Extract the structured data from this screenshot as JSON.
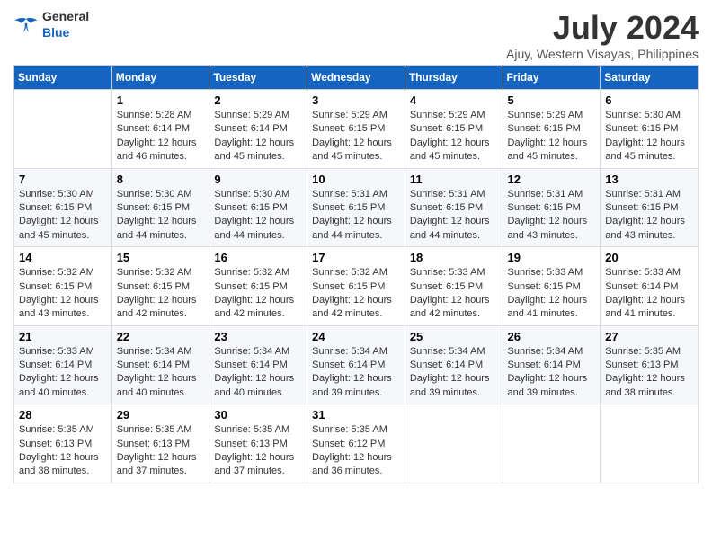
{
  "logo": {
    "general": "General",
    "blue": "Blue"
  },
  "title": "July 2024",
  "subtitle": "Ajuy, Western Visayas, Philippines",
  "header_days": [
    "Sunday",
    "Monday",
    "Tuesday",
    "Wednesday",
    "Thursday",
    "Friday",
    "Saturday"
  ],
  "weeks": [
    [
      {
        "day": "",
        "info": ""
      },
      {
        "day": "1",
        "info": "Sunrise: 5:28 AM\nSunset: 6:14 PM\nDaylight: 12 hours\nand 46 minutes."
      },
      {
        "day": "2",
        "info": "Sunrise: 5:29 AM\nSunset: 6:14 PM\nDaylight: 12 hours\nand 45 minutes."
      },
      {
        "day": "3",
        "info": "Sunrise: 5:29 AM\nSunset: 6:15 PM\nDaylight: 12 hours\nand 45 minutes."
      },
      {
        "day": "4",
        "info": "Sunrise: 5:29 AM\nSunset: 6:15 PM\nDaylight: 12 hours\nand 45 minutes."
      },
      {
        "day": "5",
        "info": "Sunrise: 5:29 AM\nSunset: 6:15 PM\nDaylight: 12 hours\nand 45 minutes."
      },
      {
        "day": "6",
        "info": "Sunrise: 5:30 AM\nSunset: 6:15 PM\nDaylight: 12 hours\nand 45 minutes."
      }
    ],
    [
      {
        "day": "7",
        "info": "Sunrise: 5:30 AM\nSunset: 6:15 PM\nDaylight: 12 hours\nand 45 minutes."
      },
      {
        "day": "8",
        "info": "Sunrise: 5:30 AM\nSunset: 6:15 PM\nDaylight: 12 hours\nand 44 minutes."
      },
      {
        "day": "9",
        "info": "Sunrise: 5:30 AM\nSunset: 6:15 PM\nDaylight: 12 hours\nand 44 minutes."
      },
      {
        "day": "10",
        "info": "Sunrise: 5:31 AM\nSunset: 6:15 PM\nDaylight: 12 hours\nand 44 minutes."
      },
      {
        "day": "11",
        "info": "Sunrise: 5:31 AM\nSunset: 6:15 PM\nDaylight: 12 hours\nand 44 minutes."
      },
      {
        "day": "12",
        "info": "Sunrise: 5:31 AM\nSunset: 6:15 PM\nDaylight: 12 hours\nand 43 minutes."
      },
      {
        "day": "13",
        "info": "Sunrise: 5:31 AM\nSunset: 6:15 PM\nDaylight: 12 hours\nand 43 minutes."
      }
    ],
    [
      {
        "day": "14",
        "info": "Sunrise: 5:32 AM\nSunset: 6:15 PM\nDaylight: 12 hours\nand 43 minutes."
      },
      {
        "day": "15",
        "info": "Sunrise: 5:32 AM\nSunset: 6:15 PM\nDaylight: 12 hours\nand 42 minutes."
      },
      {
        "day": "16",
        "info": "Sunrise: 5:32 AM\nSunset: 6:15 PM\nDaylight: 12 hours\nand 42 minutes."
      },
      {
        "day": "17",
        "info": "Sunrise: 5:32 AM\nSunset: 6:15 PM\nDaylight: 12 hours\nand 42 minutes."
      },
      {
        "day": "18",
        "info": "Sunrise: 5:33 AM\nSunset: 6:15 PM\nDaylight: 12 hours\nand 42 minutes."
      },
      {
        "day": "19",
        "info": "Sunrise: 5:33 AM\nSunset: 6:15 PM\nDaylight: 12 hours\nand 41 minutes."
      },
      {
        "day": "20",
        "info": "Sunrise: 5:33 AM\nSunset: 6:14 PM\nDaylight: 12 hours\nand 41 minutes."
      }
    ],
    [
      {
        "day": "21",
        "info": "Sunrise: 5:33 AM\nSunset: 6:14 PM\nDaylight: 12 hours\nand 40 minutes."
      },
      {
        "day": "22",
        "info": "Sunrise: 5:34 AM\nSunset: 6:14 PM\nDaylight: 12 hours\nand 40 minutes."
      },
      {
        "day": "23",
        "info": "Sunrise: 5:34 AM\nSunset: 6:14 PM\nDaylight: 12 hours\nand 40 minutes."
      },
      {
        "day": "24",
        "info": "Sunrise: 5:34 AM\nSunset: 6:14 PM\nDaylight: 12 hours\nand 39 minutes."
      },
      {
        "day": "25",
        "info": "Sunrise: 5:34 AM\nSunset: 6:14 PM\nDaylight: 12 hours\nand 39 minutes."
      },
      {
        "day": "26",
        "info": "Sunrise: 5:34 AM\nSunset: 6:14 PM\nDaylight: 12 hours\nand 39 minutes."
      },
      {
        "day": "27",
        "info": "Sunrise: 5:35 AM\nSunset: 6:13 PM\nDaylight: 12 hours\nand 38 minutes."
      }
    ],
    [
      {
        "day": "28",
        "info": "Sunrise: 5:35 AM\nSunset: 6:13 PM\nDaylight: 12 hours\nand 38 minutes."
      },
      {
        "day": "29",
        "info": "Sunrise: 5:35 AM\nSunset: 6:13 PM\nDaylight: 12 hours\nand 37 minutes."
      },
      {
        "day": "30",
        "info": "Sunrise: 5:35 AM\nSunset: 6:13 PM\nDaylight: 12 hours\nand 37 minutes."
      },
      {
        "day": "31",
        "info": "Sunrise: 5:35 AM\nSunset: 6:12 PM\nDaylight: 12 hours\nand 36 minutes."
      },
      {
        "day": "",
        "info": ""
      },
      {
        "day": "",
        "info": ""
      },
      {
        "day": "",
        "info": ""
      }
    ]
  ]
}
